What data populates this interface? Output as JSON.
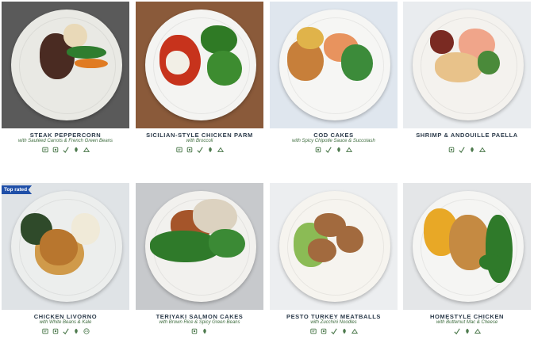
{
  "meals": [
    {
      "name": "STEAK PEPPERCORN",
      "subtitle": "with Sautéed Carrots & French Green Beans",
      "badge": "",
      "icons": [
        "calorie-icon",
        "carb-icon",
        "leaf-icon",
        "veggie-icon",
        "chef-icon"
      ],
      "bg": "#5a5a5a",
      "plate": "#e9e9e4",
      "food": [
        "#4a2b22",
        "#e9d9b8",
        "#2f7d2f",
        "#e07b22"
      ]
    },
    {
      "name": "SICILIAN-STYLE CHICKEN PARM",
      "subtitle": "with Broccoli",
      "badge": "",
      "icons": [
        "calorie-icon",
        "carb-icon",
        "leaf-icon",
        "veggie-icon",
        "chef-icon"
      ],
      "bg": "#8a5a3a",
      "plate": "#f4f4f2",
      "food": [
        "#c7331c",
        "#f2efe6",
        "#2f7a25",
        "#3d8c30"
      ]
    },
    {
      "name": "COD CAKES",
      "subtitle": "with Spicy Chipotle Sauce & Succotash",
      "badge": "",
      "icons": [
        "carb-icon",
        "leaf-icon",
        "veggie-icon",
        "chef-icon"
      ],
      "bg": "#dfe6ee",
      "plate": "#f6f6f4",
      "food": [
        "#c77f3a",
        "#e8935e",
        "#e0b34a",
        "#3c8b3a"
      ]
    },
    {
      "name": "SHRIMP & ANDOUILLE PAELLA",
      "subtitle": "",
      "badge": "",
      "icons": [
        "carb-icon",
        "leaf-icon",
        "veggie-icon",
        "chef-icon"
      ],
      "bg": "#e9ecef",
      "plate": "#f4f2ee",
      "food": [
        "#7a2a22",
        "#f0a58a",
        "#e8c28a",
        "#4a8a3a"
      ]
    },
    {
      "name": "CHICKEN LIVORNO",
      "subtitle": "with White Beans & Kale",
      "badge": "Top rated",
      "icons": [
        "calorie-icon",
        "carb-icon",
        "leaf-icon",
        "veggie-icon",
        "more-icon"
      ],
      "bg": "#dfe3e6",
      "plate": "#eceeed",
      "food": [
        "#d09a4a",
        "#2f4a2a",
        "#f0ead8",
        "#b8762e"
      ]
    },
    {
      "name": "TERIYAKI SALMON CAKES",
      "subtitle": "with Brown Rice & Spicy Green Beans",
      "badge": "",
      "icons": [
        "carb-icon",
        "veggie-icon"
      ],
      "bg": "#c7c9cc",
      "plate": "#f2f1ee",
      "food": [
        "#a5552a",
        "#dcd2c0",
        "#2f7a2a",
        "#3b8a35"
      ]
    },
    {
      "name": "PESTO TURKEY MEATBALLS",
      "subtitle": "with Zucchini Noodles",
      "badge": "",
      "icons": [
        "calorie-icon",
        "carb-icon",
        "leaf-icon",
        "veggie-icon",
        "chef-icon"
      ],
      "bg": "#eceef0",
      "plate": "#f6f4ef",
      "food": [
        "#a26a3e",
        "#d7412e",
        "#8bbb55",
        "#c4543a"
      ]
    },
    {
      "name": "HOMESTYLE CHICKEN",
      "subtitle": "with Buttemut Mac & Cheese",
      "badge": "",
      "icons": [
        "leaf-icon",
        "veggie-icon",
        "chef-icon"
      ],
      "bg": "#e4e6e8",
      "plate": "#f5f5f3",
      "food": [
        "#c58a42",
        "#f0b530",
        "#2f7a2a",
        "#e8a826"
      ]
    }
  ],
  "colors": {
    "title": "#2b3a4a",
    "subtitle": "#3f6d3f",
    "icon": "#4d7a4d",
    "badge": "#1f4fa8"
  }
}
